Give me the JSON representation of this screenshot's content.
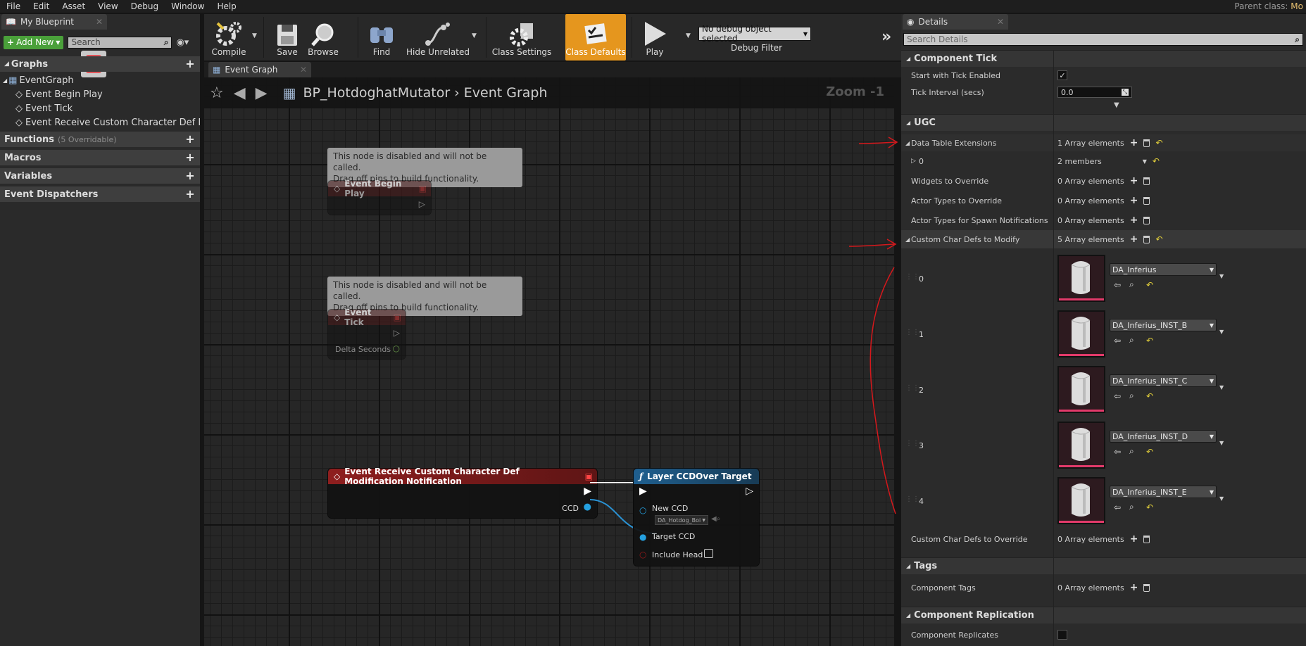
{
  "menubar": {
    "items": [
      "File",
      "Edit",
      "Asset",
      "View",
      "Debug",
      "Window",
      "Help"
    ],
    "parent_class_label": "Parent class:",
    "parent_class_value": "Mo"
  },
  "left_panel": {
    "tab_title": "My Blueprint",
    "add_new_label": "Add New",
    "search_placeholder": "Search",
    "graphs_label": "Graphs",
    "tree": [
      "EventGraph",
      "Event Begin Play",
      "Event Tick",
      "Event Receive Custom Character Def Mo"
    ],
    "functions_label": "Functions",
    "functions_sub": "(5 Overridable)",
    "macros_label": "Macros",
    "variables_label": "Variables",
    "dispatchers_label": "Event Dispatchers"
  },
  "toolbar": {
    "compile": "Compile",
    "save": "Save",
    "browse": "Browse",
    "find": "Find",
    "hide_unrelated": "Hide Unrelated",
    "class_settings": "Class Settings",
    "class_defaults": "Class Defaults",
    "play": "Play",
    "debug_object": "No debug object selected",
    "debug_filter": "Debug Filter"
  },
  "graph": {
    "tab_title": "Event Graph",
    "breadcrumb_blueprint": "BP_HotdoghatMutator",
    "breadcrumb_graph": "Event Graph",
    "zoom": "Zoom -1",
    "comment_text_1": "This node is disabled and will not be called.",
    "comment_text_2": "Drag off pins to build functionality.",
    "node_begin_play": "Event Begin Play",
    "node_tick": "Event Tick",
    "pin_delta_seconds": "Delta Seconds",
    "node_receive": "Event Receive Custom Character Def Modification Notification",
    "pin_ccd": "CCD",
    "node_layer": "Layer CCDOver Target",
    "pin_new_ccd": "New CCD",
    "pin_new_ccd_value": "DA_Hotdog_Boi",
    "pin_target_ccd": "Target CCD",
    "pin_include_head": "Include Head"
  },
  "details": {
    "tab_title": "Details",
    "search_placeholder": "Search Details",
    "cat_component_tick": "Component Tick",
    "start_with_tick": "Start with Tick Enabled",
    "tick_interval": "Tick Interval (secs)",
    "tick_interval_value": "0.0",
    "cat_ugc": "UGC",
    "data_table_ext": "Data Table Extensions",
    "data_table_ext_value": "1 Array elements",
    "index_0": "0",
    "members_value": "2 members",
    "widgets_override": "Widgets to Override",
    "actor_types_override": "Actor Types to Override",
    "actor_types_spawn": "Actor Types for Spawn Notifications",
    "custom_char_modify": "Custom Char Defs to Modify",
    "custom_char_modify_value": "5 Array elements",
    "zero_elements": "0 Array elements",
    "array_items": [
      {
        "index": "0",
        "asset": "DA_Inferius"
      },
      {
        "index": "1",
        "asset": "DA_Inferius_INST_B"
      },
      {
        "index": "2",
        "asset": "DA_Inferius_INST_C"
      },
      {
        "index": "3",
        "asset": "DA_Inferius_INST_D"
      },
      {
        "index": "4",
        "asset": "DA_Inferius_INST_E"
      }
    ],
    "custom_char_override": "Custom Char Defs to Override",
    "cat_tags": "Tags",
    "component_tags": "Component Tags",
    "cat_replication": "Component Replication",
    "component_replicates": "Component Replicates"
  },
  "colors": {
    "accent_orange": "#e5961e",
    "event_red": "#8e1e1e",
    "function_blue": "#1f5f8f",
    "annotation_red": "#d6181c"
  }
}
